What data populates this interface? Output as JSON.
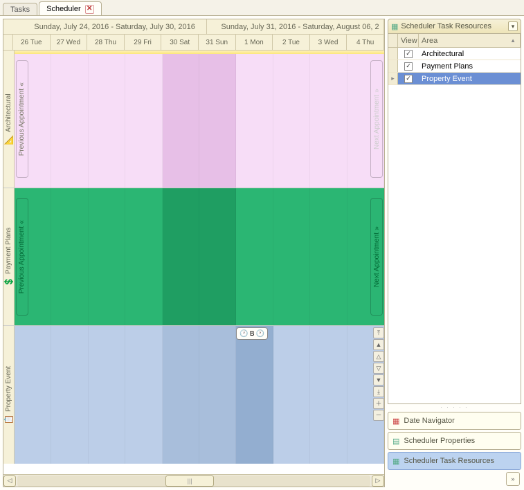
{
  "tabs": {
    "tasks": "Tasks",
    "scheduler": "Scheduler"
  },
  "weeks": [
    "Sunday, July 24, 2016 - Saturday, July 30, 2016",
    "Sunday, July 31, 2016 - Saturday, August 06, 2"
  ],
  "days": [
    "26 Tue",
    "27 Wed",
    "28 Thu",
    "29 Fri",
    "30 Sat",
    "31 Sun",
    "1 Mon",
    "2 Tue",
    "3 Wed",
    "4 Thu"
  ],
  "resources": [
    {
      "label": "Architectural",
      "icon": "📐",
      "prev": "Previous Appointment",
      "next": "Next Appointment"
    },
    {
      "label": "Payment Plans",
      "icon": "💲",
      "prev": "Previous Appointment",
      "next": "Next Appointment"
    },
    {
      "label": "Property Event",
      "icon": "📋"
    }
  ],
  "nav_arrow_prev": "«",
  "nav_arrow_next": "»",
  "event": {
    "label": "B"
  },
  "vbtns": [
    "⤒",
    "▲",
    "△",
    "▽",
    "▼",
    "⤓",
    "＋",
    "－"
  ],
  "scrollbar": {
    "thumb": "|||"
  },
  "sidebar": {
    "title": "Scheduler Task Resources",
    "cols": {
      "view": "View",
      "area": "Area"
    },
    "rows": [
      {
        "checked": true,
        "area": "Architectural",
        "selected": false,
        "current": false
      },
      {
        "checked": true,
        "area": "Payment Plans",
        "selected": false,
        "current": false
      },
      {
        "checked": true,
        "area": "Property Event",
        "selected": true,
        "current": true
      }
    ],
    "row_marker": "▸"
  },
  "panels": {
    "date_nav": "Date Navigator",
    "sched_props": "Scheduler Properties",
    "sched_res": "Scheduler Task Resources"
  },
  "collapse_glyph": "»"
}
